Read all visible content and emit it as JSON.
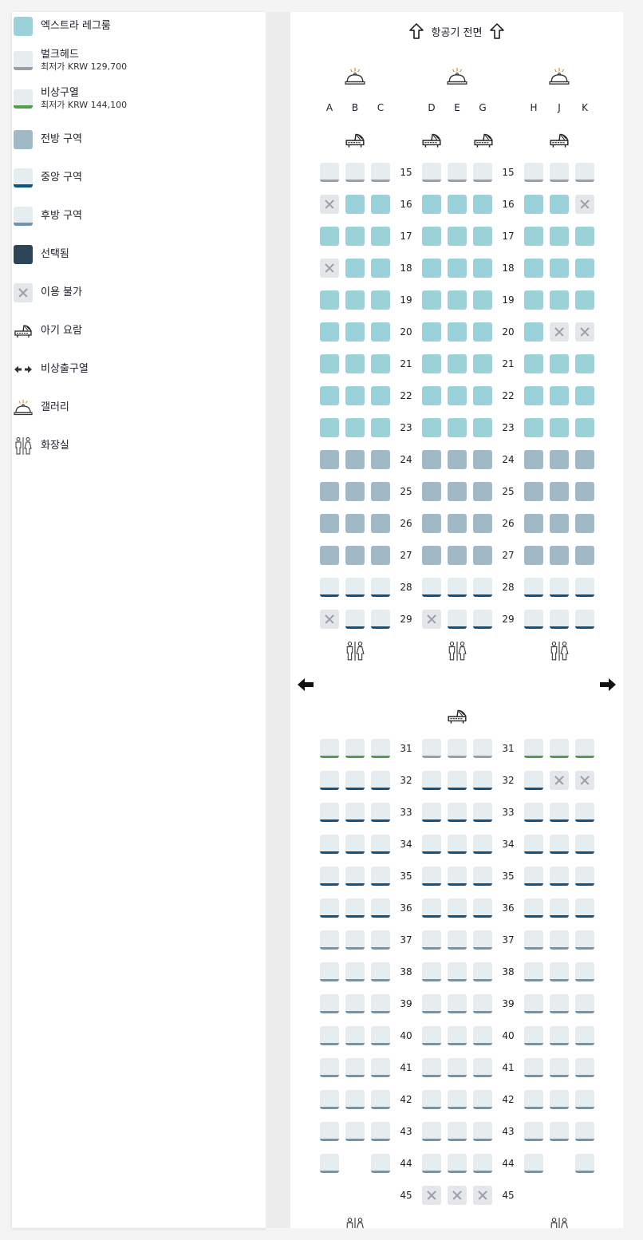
{
  "legend": [
    {
      "id": "extra-legroom",
      "label": "엑스트라 레그룸",
      "swatch": "ext"
    },
    {
      "id": "bulkhead",
      "label": "벌크헤드",
      "sub": "최저가 KRW 129,700",
      "swatch": "bulk"
    },
    {
      "id": "exit-row-seat",
      "label": "비상구열",
      "sub": "최저가 KRW 144,100",
      "swatch": "exitc"
    },
    {
      "id": "front-zone",
      "label": "전방 구역",
      "swatch": "front"
    },
    {
      "id": "middle-zone",
      "label": "중앙 구역",
      "swatch": "mid"
    },
    {
      "id": "rear-zone",
      "label": "후방 구역",
      "swatch": "back"
    },
    {
      "id": "selected",
      "label": "선택됨",
      "swatch": "sel"
    },
    {
      "id": "unavailable",
      "label": "이용 불가",
      "swatch": "na"
    },
    {
      "id": "bassinet",
      "label": "아기 요람",
      "icon": "bassinet-icon"
    },
    {
      "id": "exit-row",
      "label": "비상출구열",
      "icon": "exit-arrows-icon"
    },
    {
      "id": "galley",
      "label": "갤러리",
      "icon": "galley-icon"
    },
    {
      "id": "lavatory",
      "label": "화장실",
      "icon": "lavatory-icon"
    }
  ],
  "map": {
    "front_label": "항공기 전면",
    "columns": [
      "A",
      "B",
      "C",
      "D",
      "E",
      "G",
      "H",
      "J",
      "K"
    ],
    "colors": {
      "extra": "#9bd2d9",
      "front": "#a1b8c7",
      "middle": "#0b5385",
      "rear": "#6e95ae",
      "bulkhead": "#999ea8",
      "exit": "#4e9e4a",
      "selected": "#2c4456"
    },
    "rows": [
      {
        "n": "15",
        "s": [
          "bulk",
          "bulk",
          "bulk",
          "bulk",
          "bulk",
          "bulk",
          "bulk",
          "bulk",
          "bulk"
        ]
      },
      {
        "n": "16",
        "s": [
          "na",
          "ext",
          "ext",
          "ext",
          "ext",
          "ext",
          "ext",
          "ext",
          "na"
        ]
      },
      {
        "n": "17",
        "s": [
          "ext",
          "ext",
          "ext",
          "ext",
          "ext",
          "ext",
          "ext",
          "ext",
          "ext"
        ]
      },
      {
        "n": "18",
        "s": [
          "na",
          "ext",
          "ext",
          "ext",
          "ext",
          "ext",
          "ext",
          "ext",
          "ext"
        ]
      },
      {
        "n": "19",
        "s": [
          "ext",
          "ext",
          "ext",
          "ext",
          "ext",
          "ext",
          "ext",
          "ext",
          "ext"
        ]
      },
      {
        "n": "20",
        "s": [
          "ext",
          "ext",
          "ext",
          "ext",
          "ext",
          "ext",
          "ext",
          "na",
          "na"
        ]
      },
      {
        "n": "21",
        "s": [
          "ext",
          "ext",
          "ext",
          "ext",
          "ext",
          "ext",
          "ext",
          "ext",
          "ext"
        ]
      },
      {
        "n": "22",
        "s": [
          "ext",
          "ext",
          "ext",
          "ext",
          "ext",
          "ext",
          "ext",
          "ext",
          "ext"
        ]
      },
      {
        "n": "23",
        "s": [
          "ext",
          "ext",
          "ext",
          "ext",
          "ext",
          "ext",
          "ext",
          "ext",
          "ext"
        ]
      },
      {
        "n": "24",
        "s": [
          "front",
          "front",
          "front",
          "front",
          "front",
          "front",
          "front",
          "front",
          "front"
        ]
      },
      {
        "n": "25",
        "s": [
          "front",
          "front",
          "front",
          "front",
          "front",
          "front",
          "front",
          "front",
          "front"
        ]
      },
      {
        "n": "26",
        "s": [
          "front",
          "front",
          "front",
          "front",
          "front",
          "front",
          "front",
          "front",
          "front"
        ]
      },
      {
        "n": "27",
        "s": [
          "front",
          "front",
          "front",
          "front",
          "front",
          "front",
          "front",
          "front",
          "front"
        ]
      },
      {
        "n": "28",
        "s": [
          "mid",
          "mid",
          "mid",
          "mid",
          "mid",
          "mid",
          "mid",
          "mid",
          "mid"
        ]
      },
      {
        "n": "29",
        "s": [
          "na",
          "mid",
          "mid",
          "na",
          "mid",
          "mid",
          "mid",
          "mid",
          "mid"
        ]
      },
      {
        "n": "31",
        "s": [
          "exitc",
          "exitc",
          "exitc",
          "bulk",
          "bulk",
          "bulk",
          "exitc",
          "exitc",
          "exitc"
        ]
      },
      {
        "n": "32",
        "s": [
          "mid",
          "mid",
          "mid",
          "mid",
          "mid",
          "mid",
          "mid",
          "na",
          "na"
        ]
      },
      {
        "n": "33",
        "s": [
          "mid",
          "mid",
          "mid",
          "mid",
          "mid",
          "mid",
          "mid",
          "mid",
          "mid"
        ]
      },
      {
        "n": "34",
        "s": [
          "mid",
          "mid",
          "mid",
          "mid",
          "mid",
          "mid",
          "mid",
          "mid",
          "mid"
        ]
      },
      {
        "n": "35",
        "s": [
          "mid",
          "mid",
          "mid",
          "mid",
          "mid",
          "mid",
          "mid",
          "mid",
          "mid"
        ]
      },
      {
        "n": "36",
        "s": [
          "mid",
          "mid",
          "mid",
          "mid",
          "mid",
          "mid",
          "mid",
          "mid",
          "mid"
        ]
      },
      {
        "n": "37",
        "s": [
          "back",
          "back",
          "back",
          "back",
          "back",
          "back",
          "back",
          "back",
          "back"
        ]
      },
      {
        "n": "38",
        "s": [
          "back",
          "back",
          "back",
          "back",
          "back",
          "back",
          "back",
          "back",
          "back"
        ]
      },
      {
        "n": "39",
        "s": [
          "back",
          "back",
          "back",
          "back",
          "back",
          "back",
          "back",
          "back",
          "back"
        ]
      },
      {
        "n": "40",
        "s": [
          "back",
          "back",
          "back",
          "back",
          "back",
          "back",
          "back",
          "back",
          "back"
        ]
      },
      {
        "n": "41",
        "s": [
          "back",
          "back",
          "back",
          "back",
          "back",
          "back",
          "back",
          "back",
          "back"
        ]
      },
      {
        "n": "42",
        "s": [
          "back",
          "back",
          "back",
          "back",
          "back",
          "back",
          "back",
          "back",
          "back"
        ]
      },
      {
        "n": "43",
        "s": [
          "back",
          "back",
          "back",
          "back",
          "back",
          "back",
          "back",
          "back",
          "back"
        ]
      },
      {
        "n": "44",
        "s": [
          "back",
          "",
          "back",
          "back",
          "back",
          "back",
          "back",
          "",
          "back"
        ]
      },
      {
        "n": "45",
        "s": [
          "",
          "",
          "",
          "na",
          "na",
          "na",
          "",
          "",
          ""
        ]
      }
    ]
  }
}
